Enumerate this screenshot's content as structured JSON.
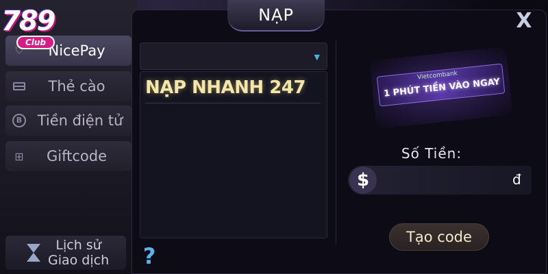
{
  "logo": {
    "number": "789",
    "sub": "Club"
  },
  "title": "NẠP",
  "close_glyph": "X",
  "sidebar": {
    "items": [
      {
        "label": "NicePay",
        "icon": "shield-icon",
        "active": true
      },
      {
        "label": "Thẻ cào",
        "icon": "card-icon",
        "active": false
      },
      {
        "label": "Tiền điện tử",
        "icon": "bitcoin-icon",
        "icon_glyph": "B",
        "active": false
      },
      {
        "label": "Giftcode",
        "icon": "gift-icon",
        "icon_glyph": "⊞",
        "active": false
      }
    ],
    "history": {
      "line1": "Lịch sử",
      "line2": "Giao dịch",
      "icon": "hourglass-icon"
    }
  },
  "method": {
    "dropdown_value": "",
    "caret": "▼",
    "options": [
      "NẠP NHANH 247"
    ]
  },
  "help_glyph": "?",
  "banner": {
    "bank": "Vietcombank",
    "text": "1 PHÚT TIỀN VÀO NGAY"
  },
  "amount": {
    "label": "Số Tiền:",
    "currency_symbol": "$",
    "value": "",
    "placeholder": "",
    "unit": "đ"
  },
  "create_button": "Tạo code",
  "colors": {
    "accent_gold": "#f3e6a8",
    "help_blue": "#5ab4ec",
    "logo_pink": "#d41b86"
  }
}
